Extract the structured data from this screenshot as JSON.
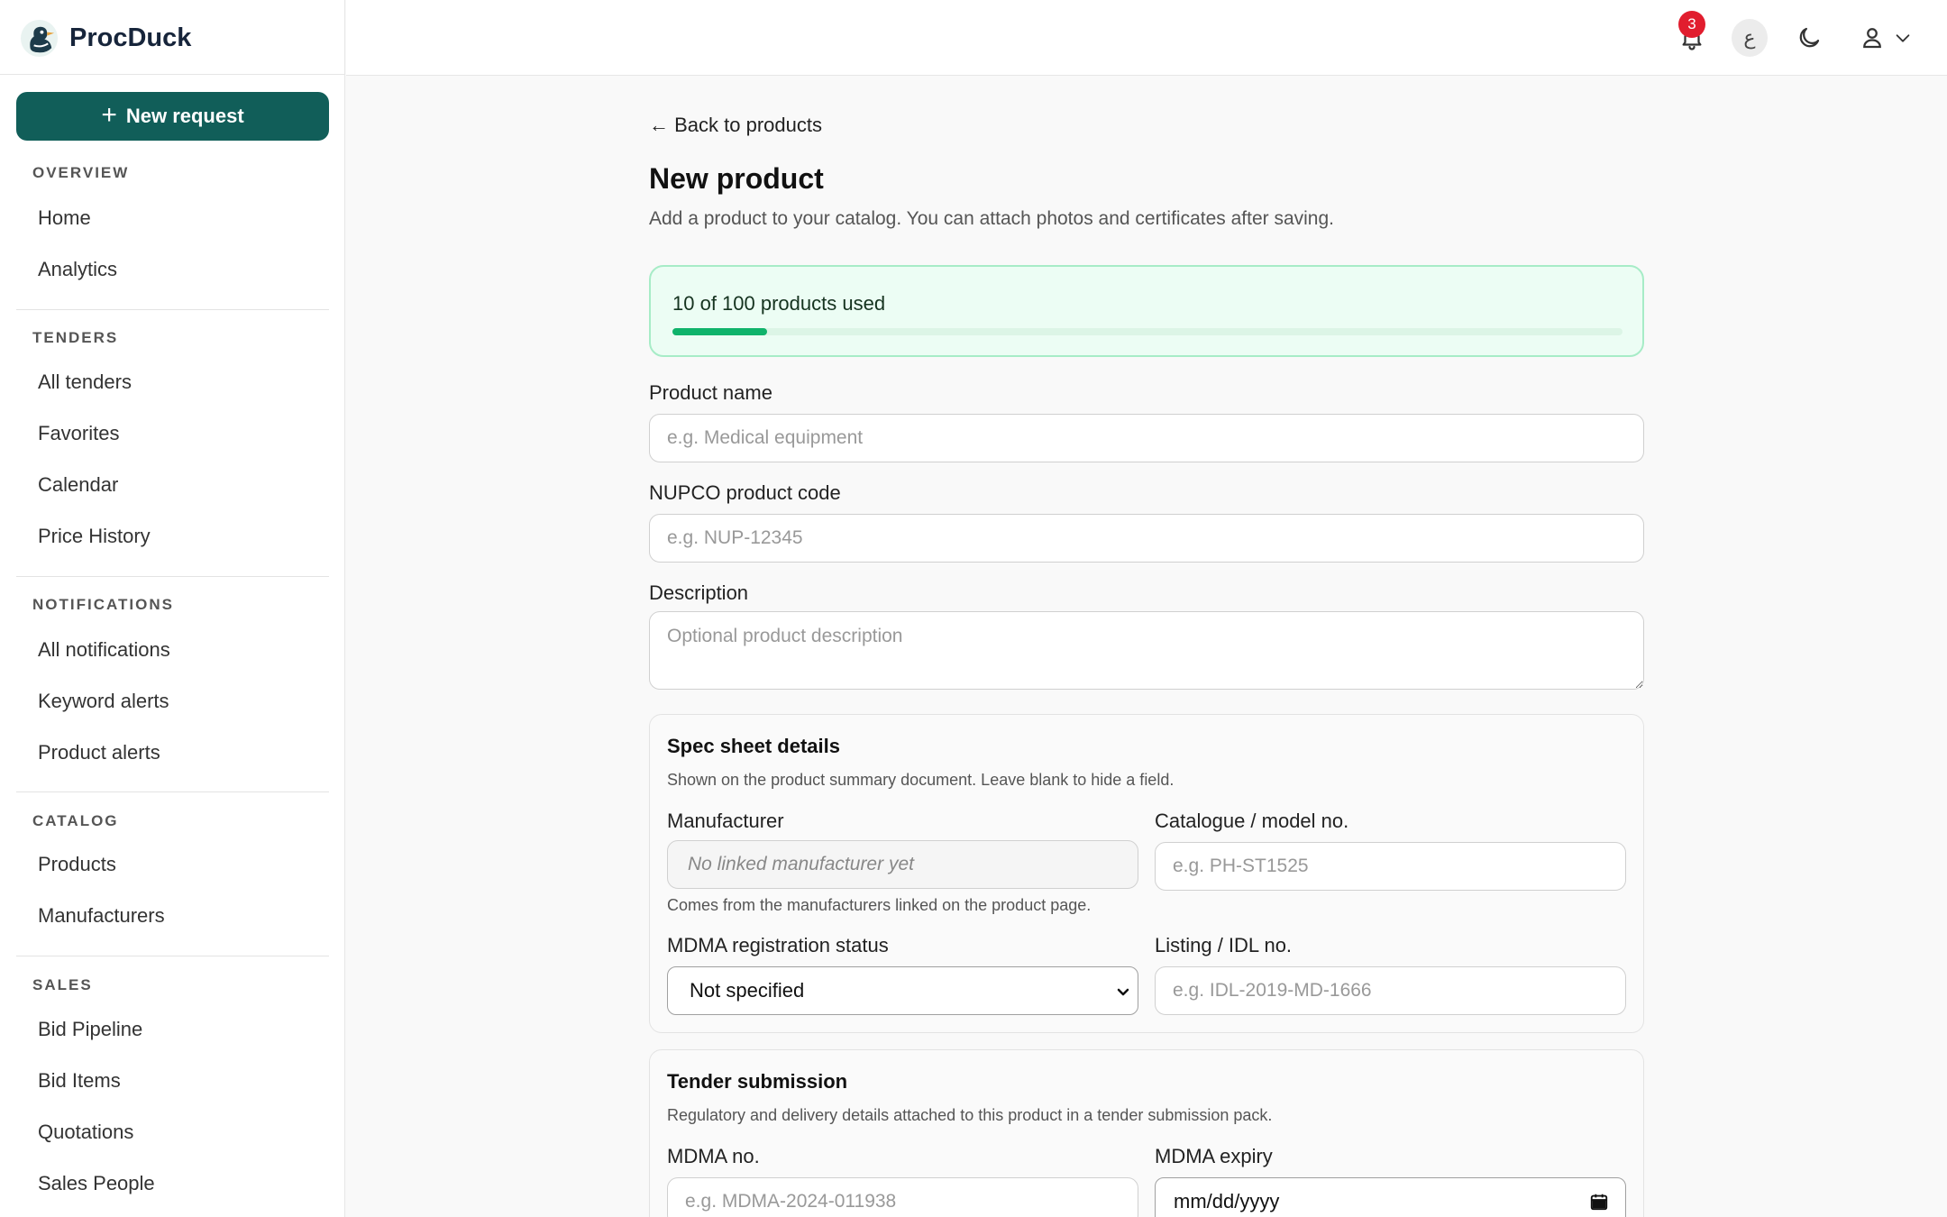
{
  "brand": {
    "name": "ProcDuck"
  },
  "sidebar": {
    "new_request_label": "New request",
    "sections": [
      {
        "title": "OVERVIEW",
        "items": [
          "Home",
          "Analytics"
        ]
      },
      {
        "title": "TENDERS",
        "items": [
          "All tenders",
          "Favorites",
          "Calendar",
          "Price History"
        ]
      },
      {
        "title": "NOTIFICATIONS",
        "items": [
          "All notifications",
          "Keyword alerts",
          "Product alerts"
        ]
      },
      {
        "title": "CATALOG",
        "items": [
          "Products",
          "Manufacturers"
        ]
      },
      {
        "title": "SALES",
        "items": [
          "Bid Pipeline",
          "Bid Items",
          "Quotations",
          "Sales People"
        ]
      }
    ]
  },
  "topbar": {
    "notification_count": "3",
    "language_glyph": "ع",
    "icons": [
      "bell-icon",
      "moon-icon",
      "user-icon",
      "chevron-down-icon"
    ]
  },
  "page": {
    "back_label": "← Back to products",
    "title": "New product",
    "subtitle": "Add a product to your catalog. You can attach photos and certificates after saving."
  },
  "usage": {
    "text": "10 of 100 products used",
    "used": 10,
    "total": 100,
    "color": "#10b36b"
  },
  "form": {
    "product_name": {
      "label": "Product name",
      "placeholder": "e.g. Medical equipment",
      "value": ""
    },
    "nupco_code": {
      "label": "NUPCO product code",
      "placeholder": "e.g. NUP-12345",
      "value": ""
    },
    "description": {
      "label": "Description",
      "placeholder": "Optional product description",
      "value": ""
    }
  },
  "spec_sheet": {
    "title": "Spec sheet details",
    "subtitle": "Shown on the product summary document. Leave blank to hide a field.",
    "manufacturer": {
      "label": "Manufacturer",
      "value": "No linked manufacturer yet",
      "hint": "Comes from the manufacturers linked on the product page."
    },
    "catalogue_no": {
      "label": "Catalogue / model no.",
      "placeholder": "e.g. PH-ST1525"
    },
    "mdma_status": {
      "label": "MDMA registration status",
      "selected": "Not specified"
    },
    "listing_no": {
      "label": "Listing / IDL no.",
      "placeholder": "e.g. IDL-2019-MD-1666"
    }
  },
  "tender": {
    "title": "Tender submission",
    "subtitle": "Regulatory and delivery details attached to this product in a tender submission pack.",
    "mdma_no": {
      "label": "MDMA no.",
      "placeholder": "e.g. MDMA-2024-011938"
    },
    "mdma_expiry": {
      "label": "MDMA expiry",
      "placeholder": "mm/dd/yyyy"
    }
  }
}
